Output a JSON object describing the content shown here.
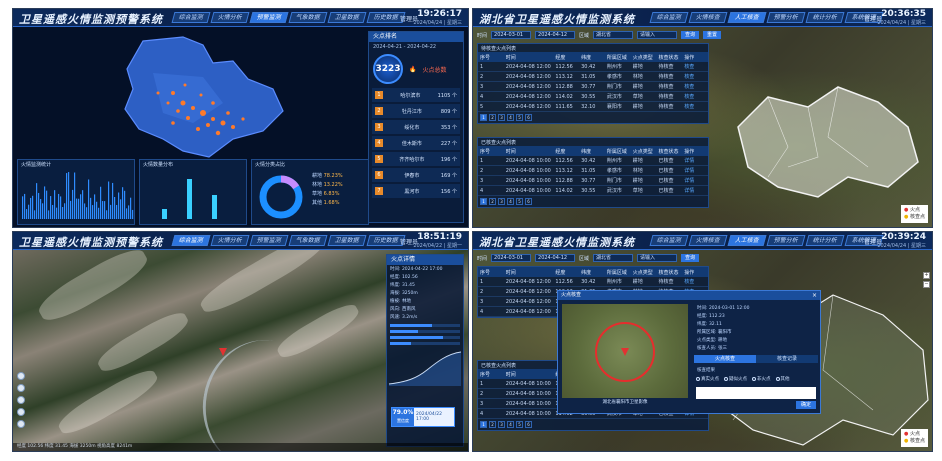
{
  "colors": {
    "brand": "#2c74e0",
    "fire": "#ff6a50",
    "danger": "#e23232",
    "panel_bg": "#041027"
  },
  "panel1": {
    "title": "卫星遥感火情监测预警系统",
    "nav": [
      "综合监测",
      "火情分析",
      "预警监测",
      "气象数据",
      "卫星数据",
      "历史数据",
      "系统管理"
    ],
    "user": "管理员",
    "clock": {
      "time": "19:26:17",
      "date": "2024/04/24 | 星期三"
    },
    "sidebar": {
      "title": "火点排名",
      "range": "2024-04-21 - 2024-04-22",
      "count": "3223",
      "count_label": "火点总数",
      "ranks": [
        {
          "no": "1",
          "name": "哈尔滨市",
          "value": "1105 个"
        },
        {
          "no": "2",
          "name": "牡丹江市",
          "value": "809 个"
        },
        {
          "no": "3",
          "name": "绥化市",
          "value": "353 个"
        },
        {
          "no": "4",
          "name": "佳木斯市",
          "value": "227 个"
        },
        {
          "no": "5",
          "name": "齐齐哈尔市",
          "value": "196 个"
        },
        {
          "no": "6",
          "name": "伊春市",
          "value": "169 个"
        },
        {
          "no": "7",
          "name": "黑河市",
          "value": "156 个"
        }
      ]
    },
    "charts": {
      "left_title": "火情监测统计",
      "mid_title": "火情数量分布",
      "right_title": "火情分类占比",
      "legend": [
        {
          "label": "耕地",
          "value": "78.23%"
        },
        {
          "label": "林地",
          "value": "13.22%"
        },
        {
          "label": "草地",
          "value": "6.83%"
        },
        {
          "label": "其他",
          "value": "1.68%"
        }
      ]
    }
  },
  "panel2": {
    "title": "湖北省卫星遥感火情监测系统",
    "nav": [
      "综合监测",
      "火情核查",
      "人工核查",
      "预警分析",
      "统计分析",
      "系统管理"
    ],
    "user": "管理员",
    "clock": {
      "time": "20:36:35",
      "date": "2024/04/24 | 星期三"
    },
    "filter": {
      "from_label": "时间",
      "from": "2024-03-01",
      "to": "2024-04-12",
      "region_label": "区域",
      "region": "湖北省",
      "search_placeholder": "请输入",
      "search_btn": "查询",
      "reset_btn": "重置"
    },
    "table1_title": "待核查火点列表",
    "headers": [
      "序号",
      "时间",
      "经度",
      "纬度",
      "所属区域",
      "火点类型",
      "核查状态",
      "操作"
    ],
    "rows": [
      [
        "1",
        "2024-04-08 12:00",
        "112.56",
        "30.42",
        "荆州市",
        "耕地",
        "待核查",
        "核查"
      ],
      [
        "2",
        "2024-04-08 12:00",
        "113.12",
        "31.05",
        "孝感市",
        "林地",
        "待核查",
        "核查"
      ],
      [
        "3",
        "2024-04-08 12:00",
        "112.88",
        "30.77",
        "荆门市",
        "耕地",
        "待核查",
        "核查"
      ],
      [
        "4",
        "2024-04-08 12:00",
        "114.02",
        "30.55",
        "武汉市",
        "草地",
        "待核查",
        "核查"
      ],
      [
        "5",
        "2024-04-08 12:00",
        "111.65",
        "32.10",
        "襄阳市",
        "耕地",
        "待核查",
        "核查"
      ]
    ],
    "table2_title": "已核查火点列表",
    "rows2": [
      [
        "1",
        "2024-04-08 10:00",
        "112.56",
        "30.42",
        "荆州市",
        "耕地",
        "已核查",
        "详情"
      ],
      [
        "2",
        "2024-04-08 10:00",
        "113.12",
        "31.05",
        "孝感市",
        "林地",
        "已核查",
        "详情"
      ],
      [
        "3",
        "2024-04-08 10:00",
        "112.88",
        "30.77",
        "荆门市",
        "耕地",
        "已核查",
        "详情"
      ],
      [
        "4",
        "2024-04-08 10:00",
        "114.02",
        "30.55",
        "武汉市",
        "草地",
        "已核查",
        "详情"
      ]
    ],
    "pager": [
      "1",
      "2",
      "3",
      "4",
      "5",
      "6"
    ],
    "legend": [
      "火点",
      "核查点"
    ]
  },
  "panel3": {
    "title": "卫星遥感火情监测预警系统",
    "nav": [
      "综合监测",
      "火情分析",
      "预警监测",
      "气象数据",
      "卫星数据",
      "历史数据"
    ],
    "user": "管理员",
    "clock": {
      "time": "18:51:19",
      "date": "2024/04/22 | 星期一"
    },
    "info_title": "火点详情",
    "info": [
      "时间: 2024-04-22 17:00",
      "经度: 102.56",
      "纬度: 31.45",
      "海拔: 3250m",
      "植被: 林地",
      "风向: 西南风",
      "风速: 3.2m/s"
    ],
    "sliders": [
      60,
      40,
      75,
      30
    ],
    "percent": "79.0%",
    "percent_label": "置信度",
    "card_time": "2024/04/22 17:00",
    "status": "经度 102.56 纬度 31.45 海拔 3250m 视角高度 8241m"
  },
  "panel4": {
    "title": "湖北省卫星遥感火情监测系统",
    "nav": [
      "综合监测",
      "火情核查",
      "人工核查",
      "预警分析",
      "统计分析",
      "系统管理"
    ],
    "user": "管理员",
    "clock": {
      "time": "20:39:24",
      "date": "2024/04/24 | 星期三"
    },
    "modal": {
      "title": "火点核查",
      "close": "×",
      "caption": "湖北省襄阳市卫星影像",
      "info": [
        "时间: 2024-03-01 12:00",
        "经度: 112.23",
        "纬度: 32.11",
        "所属区域: 襄阳市",
        "火点类型: 耕地",
        "核查人员: 张三"
      ],
      "tabs": [
        "火点核查",
        "核查记录"
      ],
      "radio_label": "核查结果",
      "radios": [
        "真实火点",
        "疑似火点",
        "非火点",
        "其他"
      ],
      "ok": "确定"
    },
    "legend": [
      "火点",
      "核查点"
    ]
  }
}
